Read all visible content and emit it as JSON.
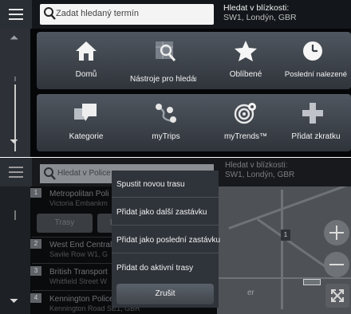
{
  "screen1": {
    "search": {
      "placeholder": "Zadat hledaný termín"
    },
    "nearby": {
      "label": "Hledat v blízkosti:",
      "location": "SW1, Londýn, GBR"
    },
    "tiles": [
      {
        "label": "Domů",
        "icon": "home-icon"
      },
      {
        "label": "Nástroje pro hledání",
        "icon": "map-search-icon"
      },
      {
        "label": "Oblíbené",
        "icon": "star-icon"
      },
      {
        "label": "Poslední nalezené",
        "icon": "clock-icon"
      },
      {
        "label": "Kategorie",
        "icon": "categories-icon"
      },
      {
        "label": "myTrips",
        "icon": "pins-icon"
      },
      {
        "label": "myTrends™",
        "icon": "trends-icon"
      },
      {
        "label": "Přidat zkratku",
        "icon": "plus-icon"
      }
    ]
  },
  "screen2": {
    "search": {
      "placeholder": "Hledat v Police"
    },
    "nearby": {
      "label": "Hledat v blízkosti:",
      "location": "SW1, Londýn, GBR"
    },
    "results": [
      {
        "num": "1",
        "title": "Metropolitan Poli",
        "sub": "Victoria Embankm"
      },
      {
        "num": "2",
        "title": "West End Central",
        "sub": "Savile Row W1, G"
      },
      {
        "num": "3",
        "title": "British Transport",
        "sub": "Whitfield Street W"
      },
      {
        "num": "4",
        "title": "Kennington Police",
        "sub": "Kennington Road SE1, GBR"
      }
    ],
    "row_buttons": {
      "routes": "Trasy",
      "second": "In"
    },
    "map_pin": "1",
    "map_text": "er",
    "menu": {
      "items": [
        "Spustit novou trasu",
        "Přidat jako další zastávku",
        "Přidat jako poslední zastávku",
        "Přidat do aktivní trasy"
      ],
      "cancel": "Zrušit"
    }
  }
}
